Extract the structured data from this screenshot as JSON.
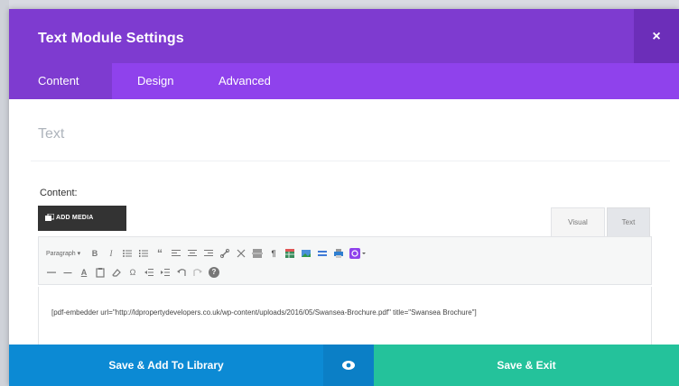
{
  "modal": {
    "title": "Text Module Settings",
    "close_symbol": "×"
  },
  "tabs": [
    {
      "label": "Content",
      "active": true
    },
    {
      "label": "Design",
      "active": false
    },
    {
      "label": "Advanced",
      "active": false
    }
  ],
  "section": {
    "title": "Text"
  },
  "content_field": {
    "label": "Content:",
    "add_media_label": "ADD MEDIA",
    "editor_tabs": [
      "Visual",
      "Text"
    ],
    "format_select": "Paragraph",
    "shortcode": "[pdf-embedder url=\"http://ldpropertydevelopers.co.uk/wp-content/uploads/2016/05/Swansea-Brochure.pdf\" title=\"Swansea Brochure\"]"
  },
  "toolbar": {
    "row1_icons": [
      "bold-icon",
      "italic-icon",
      "bullet-list-icon",
      "numbered-list-icon",
      "blockquote-icon",
      "align-left-icon",
      "align-center-icon",
      "align-right-icon",
      "link-icon",
      "unlink-icon",
      "read-more-icon",
      "hash-icon",
      "table-icon",
      "image-icon",
      "code-icon",
      "print-icon",
      "divi-icon"
    ],
    "row2_icons": [
      "horizontal-rule-icon",
      "text-color-icon",
      "paste-text-icon",
      "clear-formatting-icon",
      "special-character-icon",
      "outdent-icon",
      "indent-icon",
      "undo-icon",
      "redo-icon",
      "help-icon"
    ],
    "bold_glyph": "B",
    "italic_glyph": "I",
    "quote_glyph": "“",
    "hash_glyph": "¶",
    "strike_glyph": "—",
    "textcolor_glyph": "A",
    "omega_glyph": "Ω",
    "help_glyph": "?"
  },
  "footer": {
    "save_library_label": "Save & Add To Library",
    "save_exit_label": "Save & Exit"
  },
  "colors": {
    "header": "#7e3bd0",
    "tabs": "#8f42ec",
    "save_library": "#0c8ad4",
    "save_exit": "#24c29b"
  }
}
